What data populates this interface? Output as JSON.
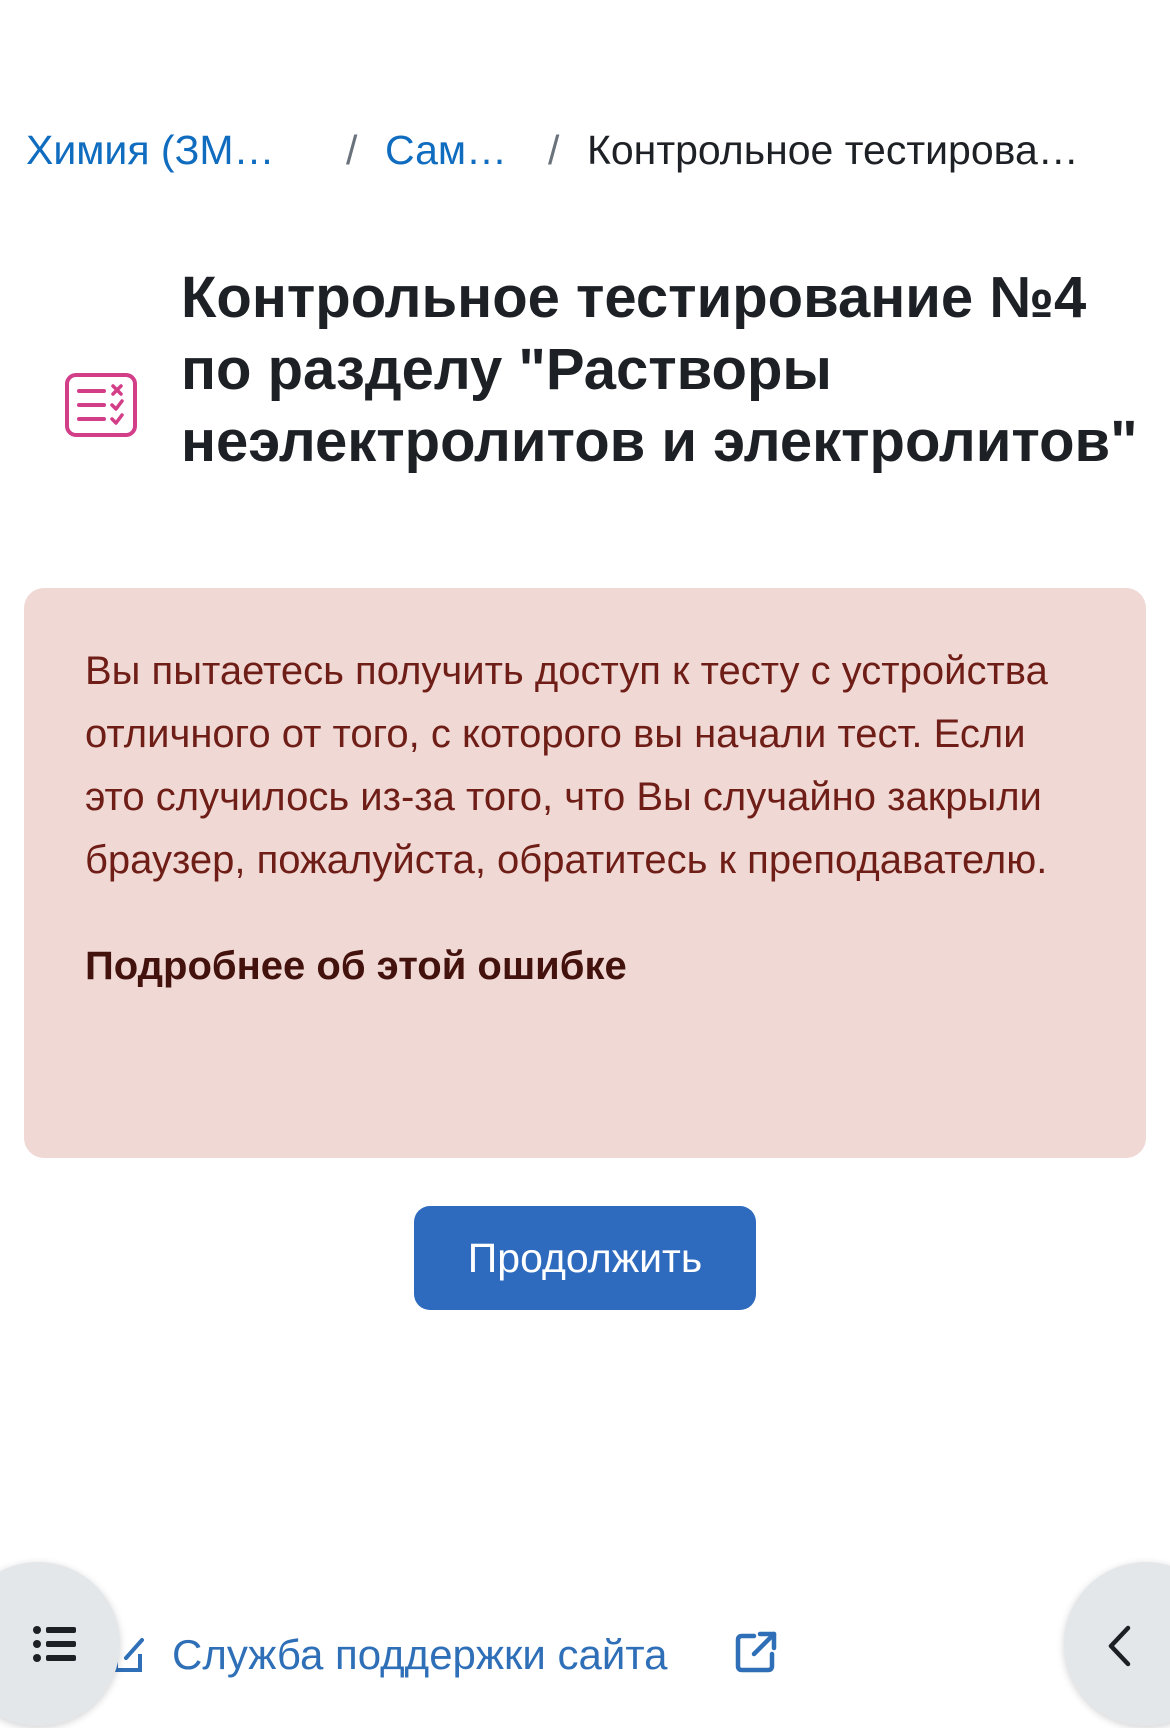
{
  "breadcrumb": {
    "items": [
      {
        "label": "Химия (ЗМ-…"
      },
      {
        "label": "Сам…"
      },
      {
        "label": "Контрольное тестирова…"
      }
    ],
    "separator": "/"
  },
  "header": {
    "icon": "quiz-icon",
    "title": "Контрольное тестирование №4 по разделу \"Растворы неэлектролитов и электролитов\""
  },
  "alert": {
    "message": "Вы пытаетесь получить доступ к тесту с устройства отличного от того, с которого вы начали тест. Если это случилось из-за того, что Вы случайно закрыли браузер, пожалуйста, обратитесь к преподавателю.",
    "more_link": "Подробнее об этой ошибке"
  },
  "actions": {
    "continue_label": "Продолжить"
  },
  "footer": {
    "support_label": "Служба поддержки сайта"
  },
  "icons": {
    "left_drawer": "list-icon",
    "right_drawer": "chevron-left-icon",
    "external": "external-link-icon"
  },
  "colors": {
    "link": "#0f6cbf",
    "primary_button": "#2e6bbf",
    "alert_background": "#f0d8d5",
    "alert_text": "#6e1e16",
    "quiz_icon": "#d33e89"
  }
}
